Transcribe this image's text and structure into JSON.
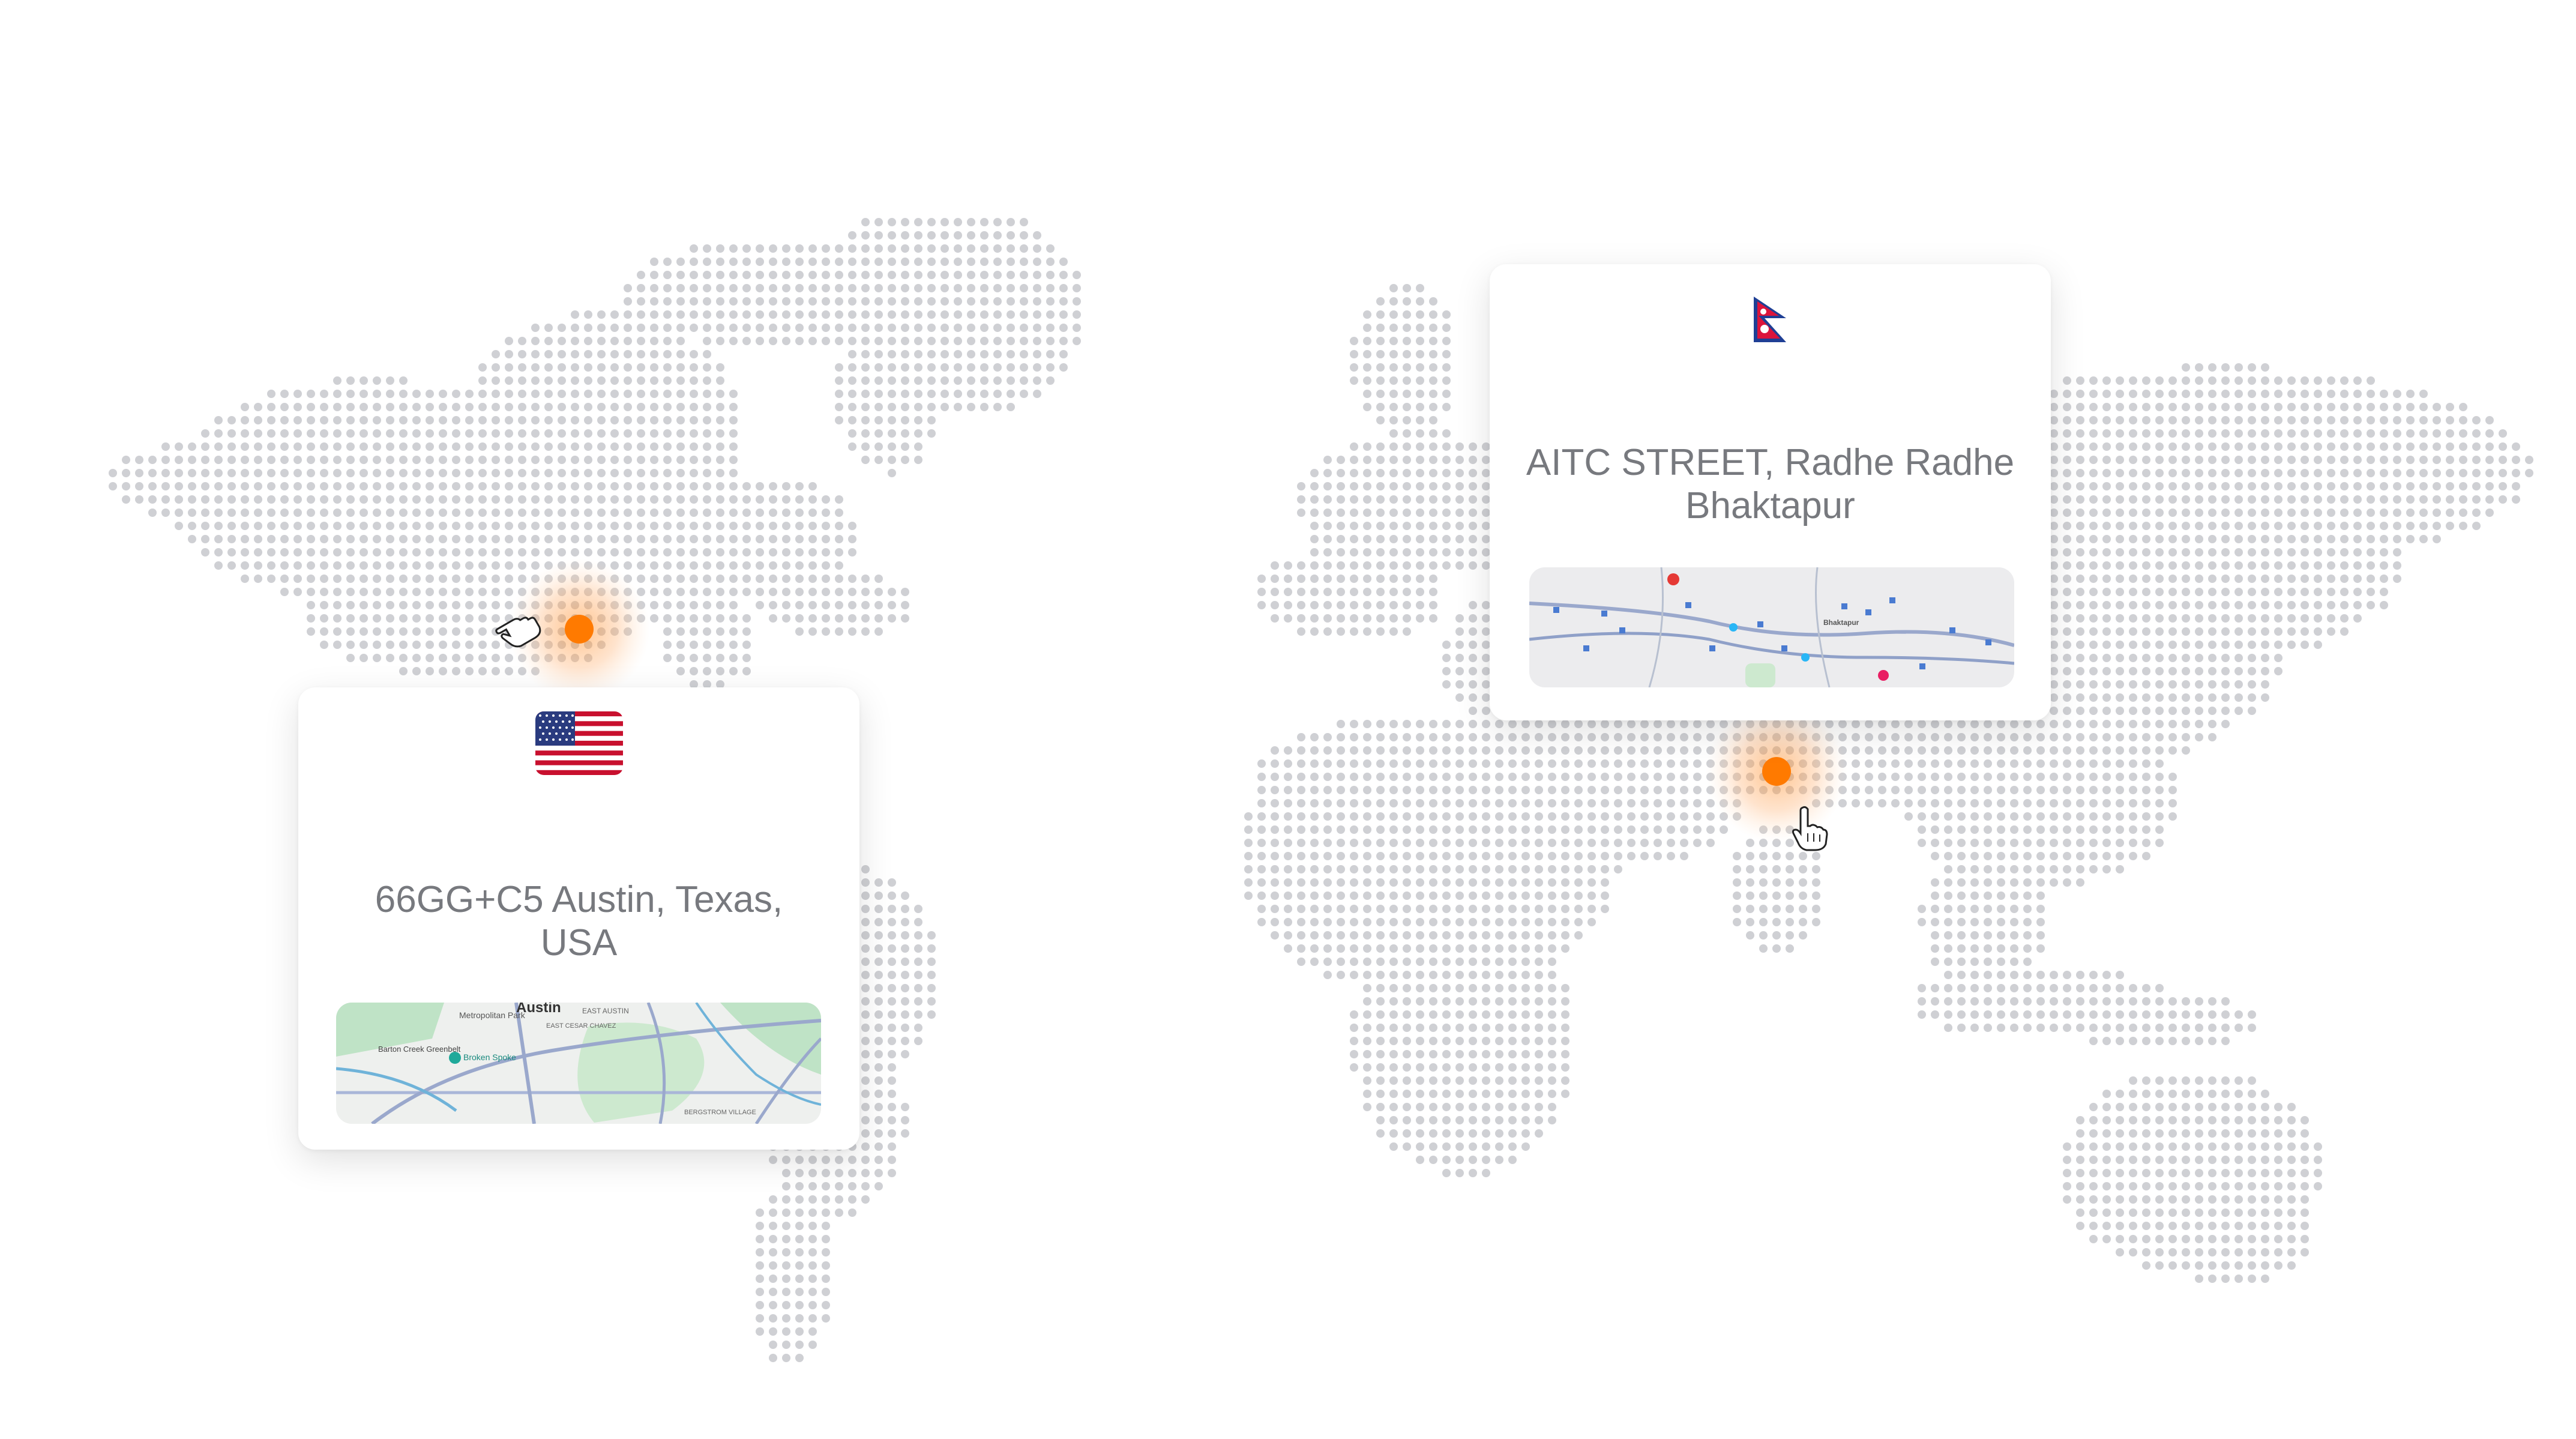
{
  "background_color": "#ffffff",
  "dot_color": "#cfd0d4",
  "accent_color": "#ff7a00",
  "cards": {
    "usa": {
      "address": "66GG+C5 Austin, Texas, USA",
      "flag_icon": "usa-flag-icon",
      "map": {
        "title": "Austin",
        "labels": [
          "Metropolitan Park",
          "EAST AUSTIN",
          "EAST CESAR CHAVEZ",
          "Barton Creek Greenbelt",
          "Broken Spoke",
          "BERGSTROM VILLAGE"
        ]
      }
    },
    "nepal": {
      "address": "AITC STREET, Radhe Radhe Bhaktapur",
      "flag_icon": "nepal-flag-icon",
      "map": {
        "title": "Bhaktapur",
        "labels": []
      }
    }
  },
  "markers": [
    {
      "name": "usa-location-marker",
      "cursor": "hand-pointer-icon"
    },
    {
      "name": "nepal-location-marker",
      "cursor": "hand-pointer-icon"
    }
  ]
}
